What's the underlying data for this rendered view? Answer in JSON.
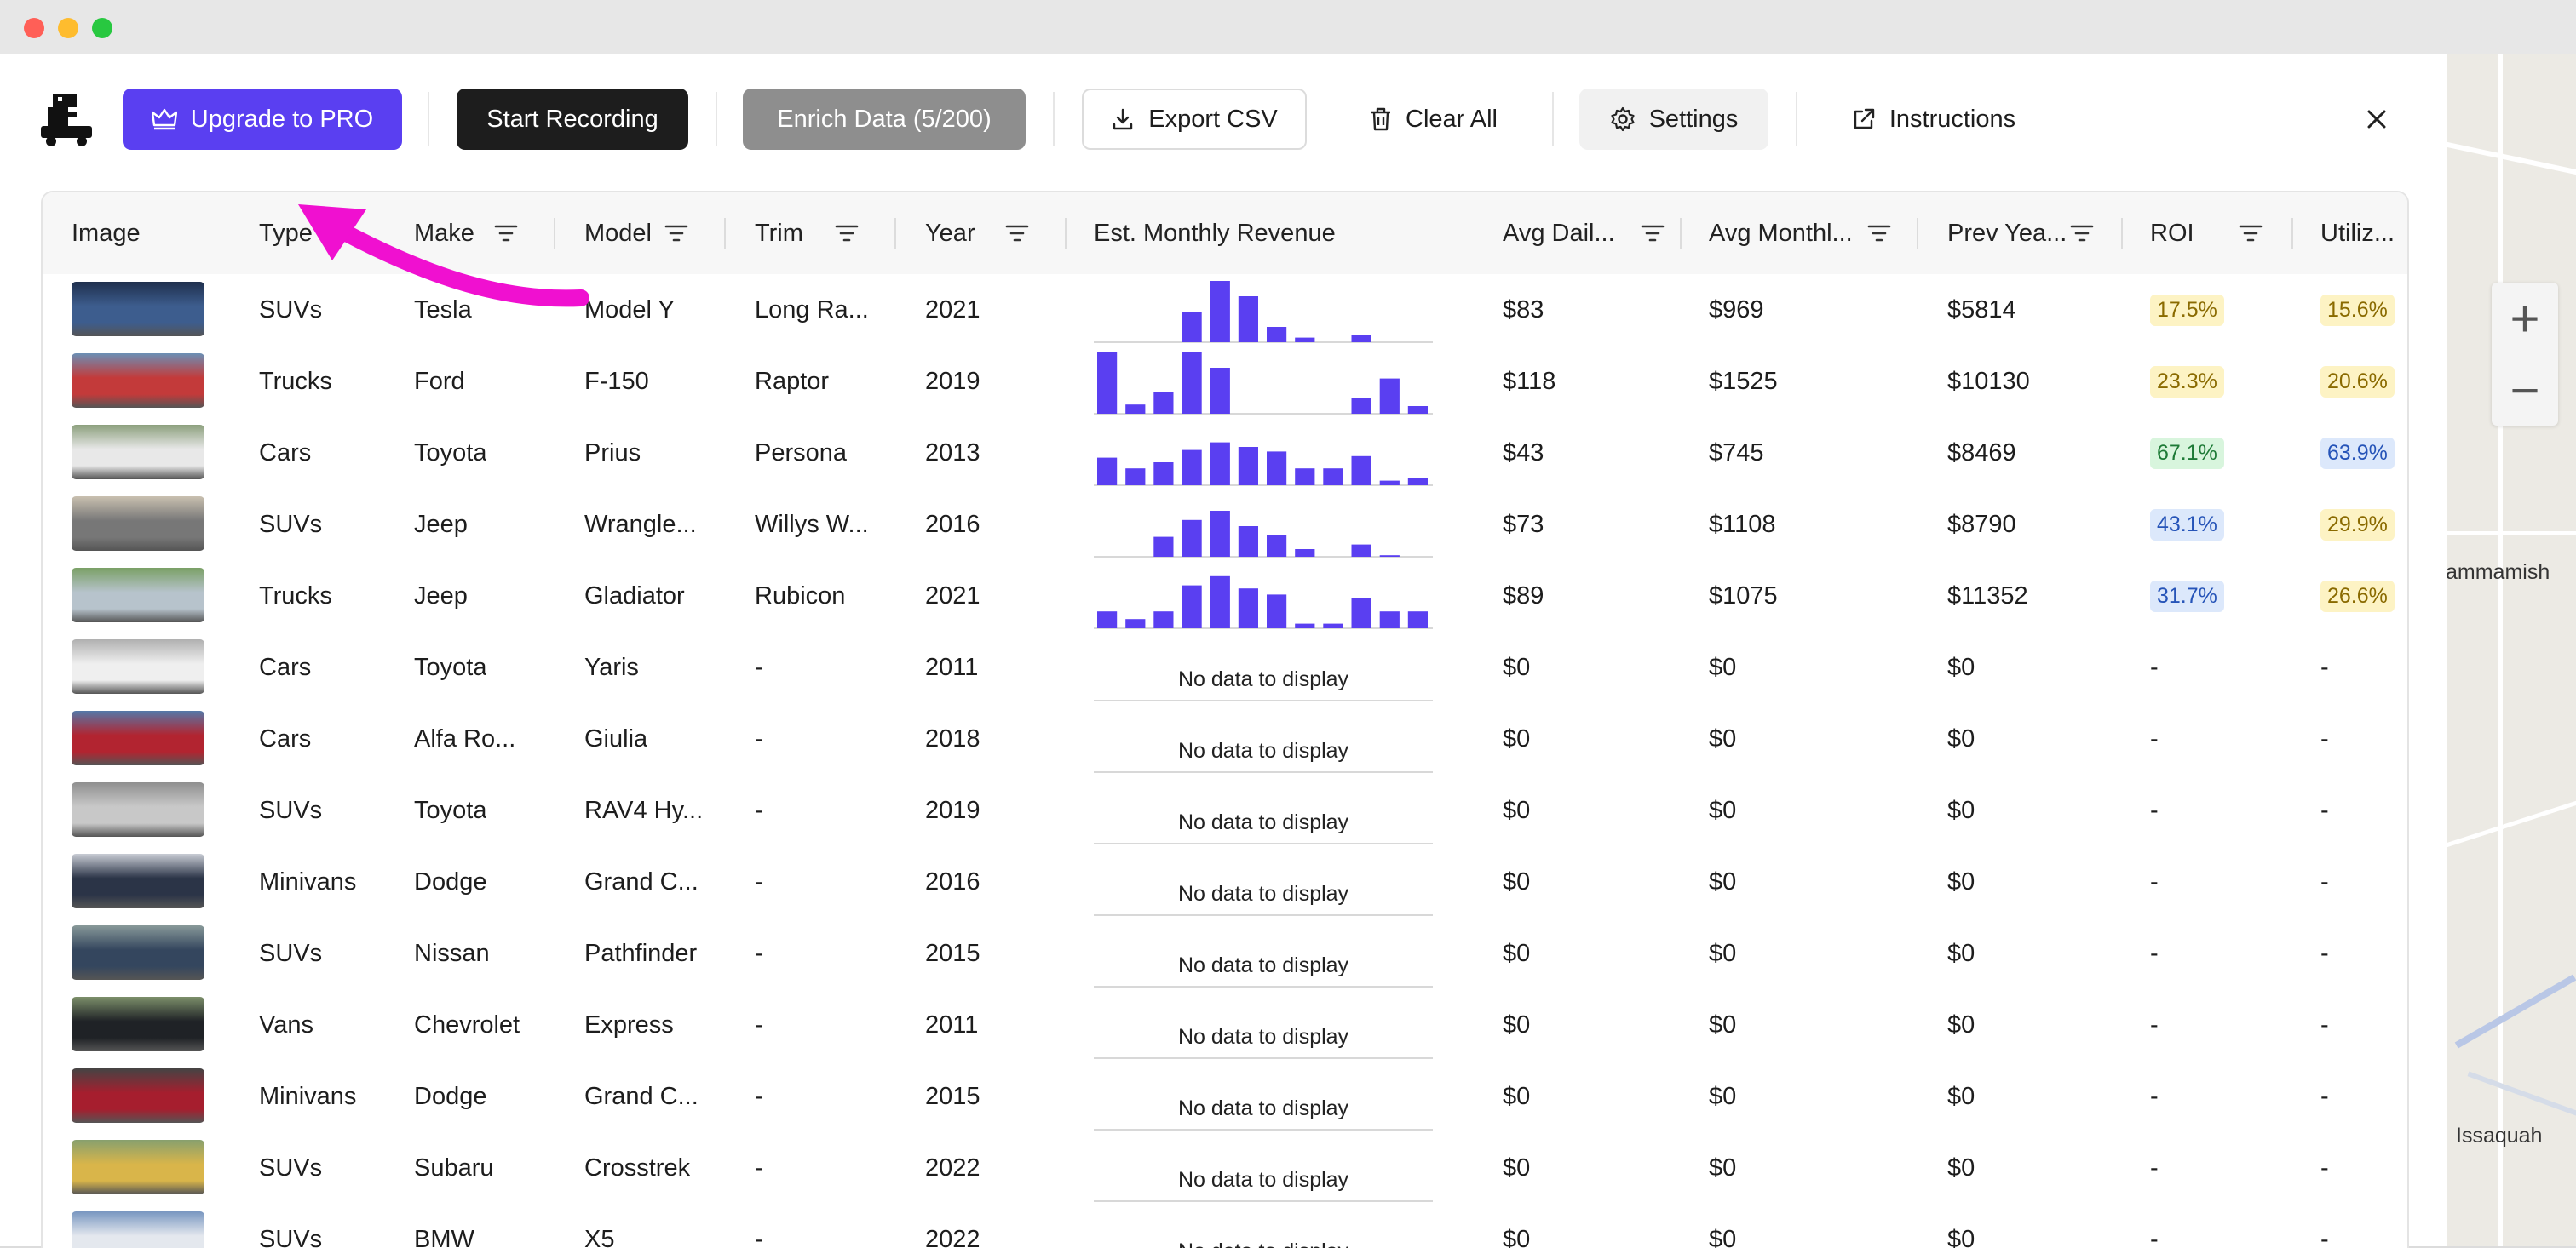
{
  "toolbar": {
    "upgrade_label": "Upgrade to PRO",
    "record_label": "Start Recording",
    "enrich_label": "Enrich Data (5/200)",
    "export_label": "Export CSV",
    "clear_label": "Clear All",
    "settings_label": "Settings",
    "instructions_label": "Instructions"
  },
  "colors": {
    "accent": "#5a3ff1",
    "bar": "#5a3ff1",
    "annotation_arrow": "#f010d0",
    "badge_yellow_bg": "#fdf3c4",
    "badge_yellow_fg": "#8a6a00",
    "badge_green_bg": "#d8f5dd",
    "badge_green_fg": "#1d7a36",
    "badge_blue_bg": "#dce8fb",
    "badge_blue_fg": "#2654b8"
  },
  "map": {
    "labels": [
      "ammamish",
      "Issaquah"
    ]
  },
  "table": {
    "columns": [
      "Image",
      "Type",
      "Make",
      "Model",
      "Trim",
      "Year",
      "Est. Monthly Revenue",
      "Avg Dail...",
      "Avg Monthl...",
      "Prev Yea...",
      "ROI",
      "Utiliz..."
    ],
    "no_data_text": "No data to display",
    "rows": [
      {
        "image": "blue-suv-photo",
        "type": "SUVs",
        "make": "Tesla",
        "model": "Model Y",
        "trim": "Long Ra...",
        "year": "2021",
        "revenue": [
          0,
          0,
          0,
          2,
          4,
          3,
          1,
          0.3,
          0,
          0.5,
          0
        ],
        "avg_daily": "$83",
        "avg_monthly": "$969",
        "prev_year": "$5814",
        "roi": "17.5%",
        "roi_tone": "yellow",
        "util": "15.6%",
        "util_tone": "yellow"
      },
      {
        "image": "red-truck-photo",
        "type": "Trucks",
        "make": "Ford",
        "model": "F-150",
        "trim": "Raptor",
        "year": "2019",
        "revenue": [
          4,
          0.6,
          1.4,
          4,
          3,
          0,
          0,
          0,
          0,
          1,
          2.3,
          0.5
        ],
        "avg_daily": "$118",
        "avg_monthly": "$1525",
        "prev_year": "$10130",
        "roi": "23.3%",
        "roi_tone": "yellow",
        "util": "20.6%",
        "util_tone": "yellow"
      },
      {
        "image": "white-car-photo",
        "type": "Cars",
        "make": "Toyota",
        "model": "Prius",
        "trim": "Persona",
        "year": "2013",
        "revenue": [
          1.8,
          1.1,
          1.5,
          2.3,
          2.8,
          2.5,
          2.2,
          1.1,
          1.1,
          1.9,
          0.3,
          0.5
        ],
        "avg_daily": "$43",
        "avg_monthly": "$745",
        "prev_year": "$8469",
        "roi": "67.1%",
        "roi_tone": "green",
        "util": "63.9%",
        "util_tone": "blue"
      },
      {
        "image": "gray-jeep-photo",
        "type": "SUVs",
        "make": "Jeep",
        "model": "Wrangle...",
        "trim": "Willys W...",
        "year": "2016",
        "revenue": [
          0,
          0,
          1.3,
          2.4,
          3,
          2,
          1.4,
          0.5,
          0,
          0.8,
          0.1,
          0
        ],
        "avg_daily": "$73",
        "avg_monthly": "$1108",
        "prev_year": "$8790",
        "roi": "43.1%",
        "roi_tone": "blue",
        "util": "29.9%",
        "util_tone": "yellow"
      },
      {
        "image": "silver-truck-photo",
        "type": "Trucks",
        "make": "Jeep",
        "model": "Gladiator",
        "trim": "Rubicon",
        "year": "2021",
        "revenue": [
          1.1,
          0.6,
          1.1,
          2.8,
          3.4,
          2.6,
          2.2,
          0.3,
          0.3,
          2,
          1.1,
          1.1
        ],
        "avg_daily": "$89",
        "avg_monthly": "$1075",
        "prev_year": "$11352",
        "roi": "31.7%",
        "roi_tone": "blue",
        "util": "26.6%",
        "util_tone": "yellow"
      },
      {
        "image": "white-sedan-photo",
        "type": "Cars",
        "make": "Toyota",
        "model": "Yaris",
        "trim": "-",
        "year": "2011",
        "revenue": [],
        "avg_daily": "$0",
        "avg_monthly": "$0",
        "prev_year": "$0",
        "roi": "-",
        "util": "-"
      },
      {
        "image": "red-sedan-photo",
        "type": "Cars",
        "make": "Alfa Ro...",
        "model": "Giulia",
        "trim": "-",
        "year": "2018",
        "revenue": [],
        "avg_daily": "$0",
        "avg_monthly": "$0",
        "prev_year": "$0",
        "roi": "-",
        "util": "-"
      },
      {
        "image": "silver-suv-photo",
        "type": "SUVs",
        "make": "Toyota",
        "model": "RAV4 Hy...",
        "trim": "-",
        "year": "2019",
        "revenue": [],
        "avg_daily": "$0",
        "avg_monthly": "$0",
        "prev_year": "$0",
        "roi": "-",
        "util": "-"
      },
      {
        "image": "dark-minivan-photo",
        "type": "Minivans",
        "make": "Dodge",
        "model": "Grand C...",
        "trim": "-",
        "year": "2016",
        "revenue": [],
        "avg_daily": "$0",
        "avg_monthly": "$0",
        "prev_year": "$0",
        "roi": "-",
        "util": "-"
      },
      {
        "image": "dark-suv-photo",
        "type": "SUVs",
        "make": "Nissan",
        "model": "Pathfinder",
        "trim": "-",
        "year": "2015",
        "revenue": [],
        "avg_daily": "$0",
        "avg_monthly": "$0",
        "prev_year": "$0",
        "roi": "-",
        "util": "-"
      },
      {
        "image": "black-van-photo",
        "type": "Vans",
        "make": "Chevrolet",
        "model": "Express",
        "trim": "-",
        "year": "2011",
        "revenue": [],
        "avg_daily": "$0",
        "avg_monthly": "$0",
        "prev_year": "$0",
        "roi": "-",
        "util": "-"
      },
      {
        "image": "red-minivan-photo",
        "type": "Minivans",
        "make": "Dodge",
        "model": "Grand C...",
        "trim": "-",
        "year": "2015",
        "revenue": [],
        "avg_daily": "$0",
        "avg_monthly": "$0",
        "prev_year": "$0",
        "roi": "-",
        "util": "-"
      },
      {
        "image": "yellow-suv-photo",
        "type": "SUVs",
        "make": "Subaru",
        "model": "Crosstrek",
        "trim": "-",
        "year": "2022",
        "revenue": [],
        "avg_daily": "$0",
        "avg_monthly": "$0",
        "prev_year": "$0",
        "roi": "-",
        "util": "-"
      },
      {
        "image": "white-bmw-photo",
        "type": "SUVs",
        "make": "BMW",
        "model": "X5",
        "trim": "-",
        "year": "2022",
        "revenue": [],
        "avg_daily": "$0",
        "avg_monthly": "$0",
        "prev_year": "$0",
        "roi": "-",
        "util": "-"
      }
    ]
  }
}
